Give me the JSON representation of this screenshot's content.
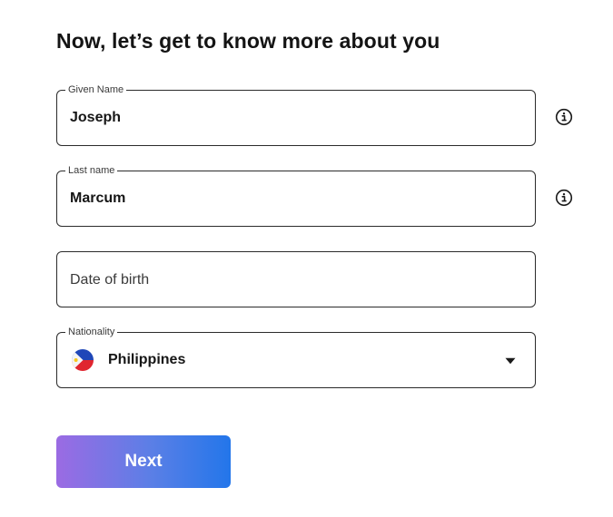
{
  "page": {
    "heading": "Now, let’s get to know more about you"
  },
  "fields": {
    "given_name": {
      "label": "Given Name",
      "value": "Joseph",
      "icon": "info-icon"
    },
    "last_name": {
      "label": "Last name",
      "value": "Marcum",
      "icon": "info-icon"
    },
    "date_of_birth": {
      "placeholder": "Date of birth",
      "value": ""
    },
    "nationality": {
      "label": "Nationality",
      "selected": "Philippines",
      "flag_icon": "philippines-flag-icon",
      "dropdown_icon": "caret-down-icon"
    }
  },
  "actions": {
    "next_label": "Next"
  },
  "colors": {
    "border": "#2b2b2b",
    "button_gradient_start": "#9b6be3",
    "button_gradient_end": "#2376ea",
    "button_text": "#ffffff"
  }
}
